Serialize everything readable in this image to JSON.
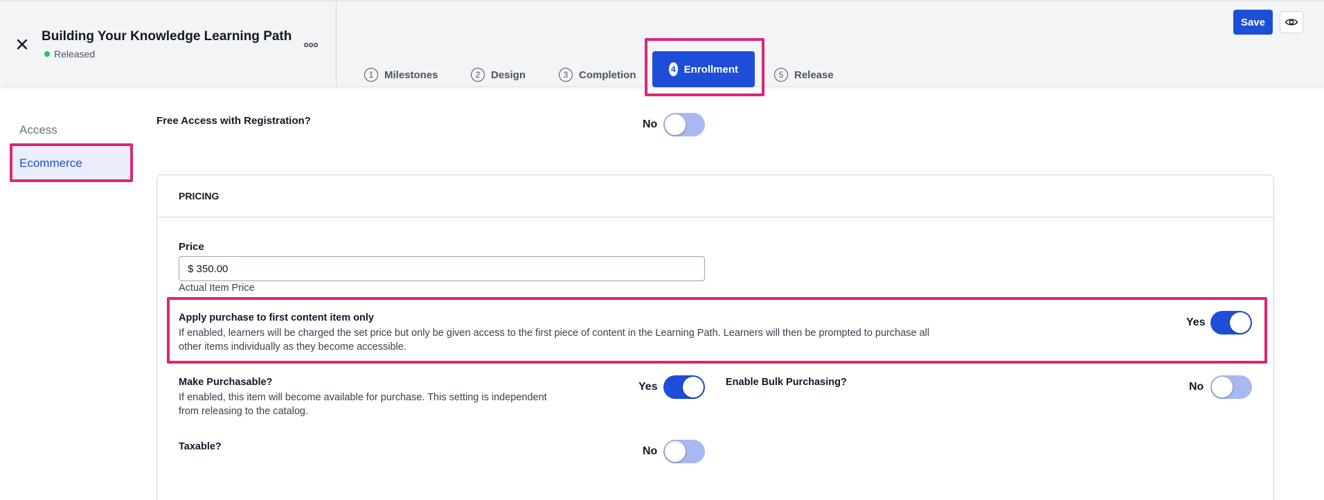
{
  "header": {
    "title": "Building Your Knowledge Learning Path",
    "status": "Released",
    "save_label": "Save"
  },
  "steps": [
    {
      "num": "1",
      "label": "Milestones"
    },
    {
      "num": "2",
      "label": "Design"
    },
    {
      "num": "3",
      "label": "Completion"
    },
    {
      "num": "4",
      "label": "Enrollment",
      "active": true
    },
    {
      "num": "5",
      "label": "Release"
    }
  ],
  "sidebar": {
    "items": [
      {
        "label": "Access"
      },
      {
        "label": "Ecommerce",
        "active": true
      }
    ]
  },
  "main": {
    "free_access": {
      "label": "Free Access with Registration?",
      "value": "No"
    },
    "pricing": {
      "heading": "PRICING",
      "price_label": "Price",
      "price_value": "$ 350.00",
      "price_hint": "Actual Item Price",
      "apply_first": {
        "label": "Apply purchase to first content item only",
        "desc_line1": "If enabled, learners will be charged the set price but only be given access to the first piece of content in the Learning Path. Learners will then be prompted to purchase all",
        "desc_line2": "other items individually as they become accessible.",
        "value": "Yes"
      },
      "purchasable": {
        "label": "Make Purchasable?",
        "desc_line1": "If enabled, this item will become available for purchase. This setting is independent",
        "desc_line2": "from releasing to the catalog.",
        "value": "Yes"
      },
      "bulk": {
        "label": "Enable Bulk Purchasing?",
        "value": "No"
      },
      "taxable": {
        "label": "Taxable?",
        "value": "No"
      }
    }
  },
  "colors": {
    "accent": "#1d4ed8",
    "highlight": "#db2777",
    "status_green": "#22c55e"
  }
}
